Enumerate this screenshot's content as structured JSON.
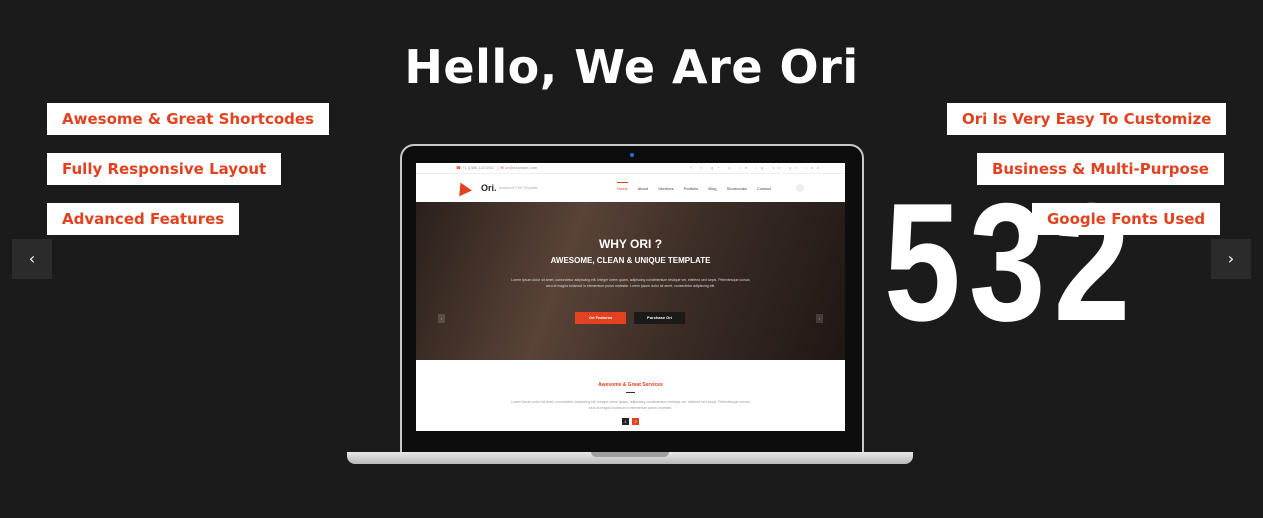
{
  "title": "Hello, We Are Ori",
  "left_tags": [
    "Awesome & Great Shortcodes",
    "Fully Responsive Layout",
    "Advanced Features"
  ],
  "right_tags": [
    "Ori Is Very Easy To Customize",
    "Business & Multi-Purpose",
    "Google Fonts Used"
  ],
  "big_number": "532",
  "arrows": {
    "prev": "‹",
    "next": "›"
  },
  "screen": {
    "topbar": {
      "phone": "+1 (0)86 123 4567",
      "email": "ori@example.com",
      "social": "f t g+ p in ig vk yt rss"
    },
    "logo": "Ori.",
    "logo_sub": "Awesome PSD Template",
    "menu": [
      "Home",
      "About",
      "Services",
      "Portfolio",
      "Blog",
      "Shortcodes",
      "Contact"
    ],
    "hero_title": "WHY ORI ?",
    "hero_subtitle": "AWESOME, CLEAN & UNIQUE TEMPLATE",
    "hero_text": "Lorem ipsum dolor sit amet, consectetur adipiscing elit. Integer lorem quam, adipiscing condimentum tristique vel, eleifend sed turpis. Pellentesque cursus arcu id magna euismod in elementum purus molestie. Lorem ipsum dolor sit amet, consectetur adipiscing elit.",
    "btn_features": "Ori Features",
    "btn_purchase": "Purchase Ori",
    "section_title": "Awesome & Great Services",
    "section_text": "Lorem ipsum dolor sit amet, consectetur adipiscing elit. Integer lorem quam, adipiscing condimentum tristique vel, eleifend sed turpis. Pellentesque cursus arcu id magna euismod in elementum purus molestie.",
    "page1": "1",
    "page2": "2"
  },
  "colors": {
    "accent": "#e2421f",
    "background": "#1b1b1b"
  }
}
